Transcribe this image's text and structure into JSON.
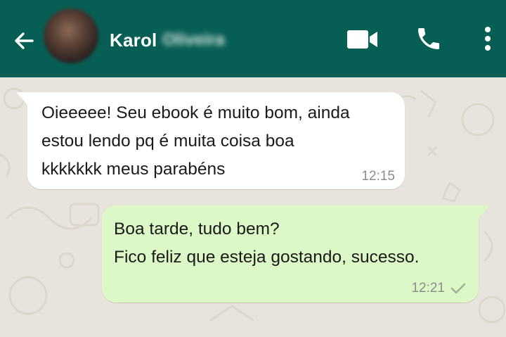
{
  "header": {
    "contact_first_name": "Karol",
    "contact_last_name_blurred": "Oliveira",
    "background_color": "#075e54",
    "icons": [
      "back-arrow-icon",
      "video-call-icon",
      "phone-icon",
      "more-vert-icon"
    ]
  },
  "messages": [
    {
      "direction": "incoming",
      "text": "Oieeeee! Seu ebook é muito bom, ainda\nestou lendo pq é muita coisa boa\nkkkkkkk meus parabéns",
      "time": "12:15",
      "bubble_color": "#ffffff"
    },
    {
      "direction": "outgoing",
      "text": "Boa tarde, tudo bem?\nFico feliz que esteja gostando, sucesso.",
      "time": "12:21",
      "status_icon": "single-check-icon",
      "bubble_color": "#dcf8c6"
    }
  ],
  "chat_background": "#e8e3dc"
}
